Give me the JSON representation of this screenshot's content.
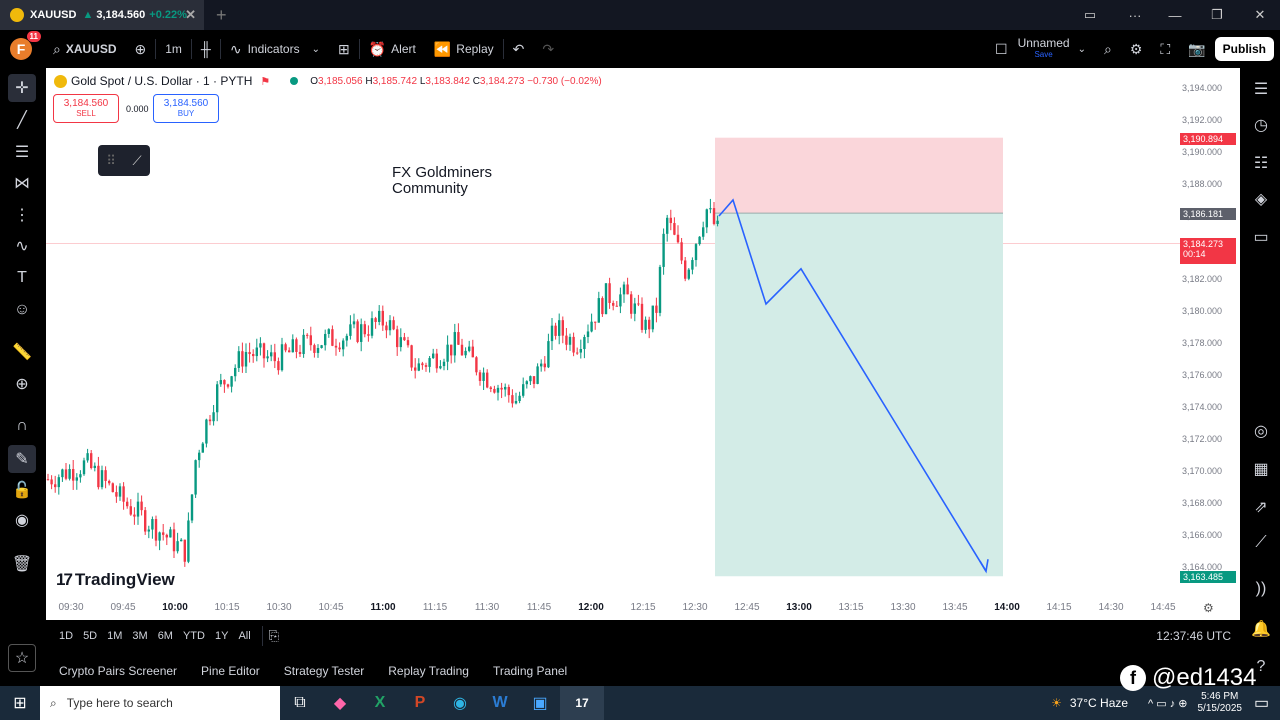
{
  "browser_tab": {
    "symbol": "XAUUSD",
    "arrow": "▲",
    "price": "3,184.560",
    "change": "+0.22%"
  },
  "toolbar": {
    "avatar_letter": "F",
    "avatar_badge": "11",
    "symbol": "XAUUSD",
    "interval": "1m",
    "indicators": "Indicators",
    "alert": "Alert",
    "replay": "Replay",
    "layout_name": "Unnamed",
    "layout_sub": "Save",
    "publish": "Publish"
  },
  "legend": {
    "title": "Gold Spot / U.S. Dollar · 1 · PYTH",
    "o_label": "O",
    "o": "3,185.056",
    "h_label": "H",
    "h": "3,185.742",
    "l_label": "L",
    "l": "3,183.842",
    "c_label": "C",
    "c": "3,184.273",
    "change": "−0.730 (−0.02%)"
  },
  "trade": {
    "sell_price": "3,184.560",
    "sell_label": "SELL",
    "spread": "0.000",
    "buy_price": "3,184.560",
    "buy_label": "BUY"
  },
  "watermark": {
    "line1": "FX Goldminers",
    "line2": "Community"
  },
  "tv_logo": "TradingView",
  "price_axis": [
    "3,194.000",
    "3,192.000",
    "3,190.000",
    "3,188.000",
    "3,186.000",
    "3,184.000",
    "3,182.000",
    "3,180.000",
    "3,178.000",
    "3,176.000",
    "3,174.000",
    "3,172.000",
    "3,170.000",
    "3,168.000",
    "3,166.000",
    "3,164.000"
  ],
  "price_tags": {
    "stop": "3,190.894",
    "entry": "3,186.181",
    "current": "3,184.273",
    "countdown": "00:14",
    "target": "3,163.485"
  },
  "time_axis": [
    "09:30",
    "09:45",
    "10:00",
    "10:15",
    "10:30",
    "10:45",
    "11:00",
    "11:15",
    "11:30",
    "11:45",
    "12:00",
    "12:15",
    "12:30",
    "12:45",
    "13:00",
    "13:15",
    "13:30",
    "13:45",
    "14:00",
    "14:15",
    "14:30",
    "14:45"
  ],
  "range_bar": {
    "ranges": [
      "1D",
      "5D",
      "1M",
      "3M",
      "6M",
      "YTD",
      "1Y",
      "All"
    ],
    "clock": "12:37:46 UTC"
  },
  "bottom_panel": [
    "Crypto Pairs Screener",
    "Pine Editor",
    "Strategy Tester",
    "Replay Trading",
    "Trading Panel"
  ],
  "taskbar": {
    "search_placeholder": "Type here to search",
    "weather": "37°C  Haze",
    "time": "5:46 PM",
    "date": "5/15/2025",
    "weather_badge": "1"
  },
  "overlay_handle": "@ed1434",
  "colors": {
    "up": "#089981",
    "down": "#f23645",
    "stop_zone": "#fad6da",
    "target_zone": "#d3ece7",
    "projection": "#2962ff"
  }
}
